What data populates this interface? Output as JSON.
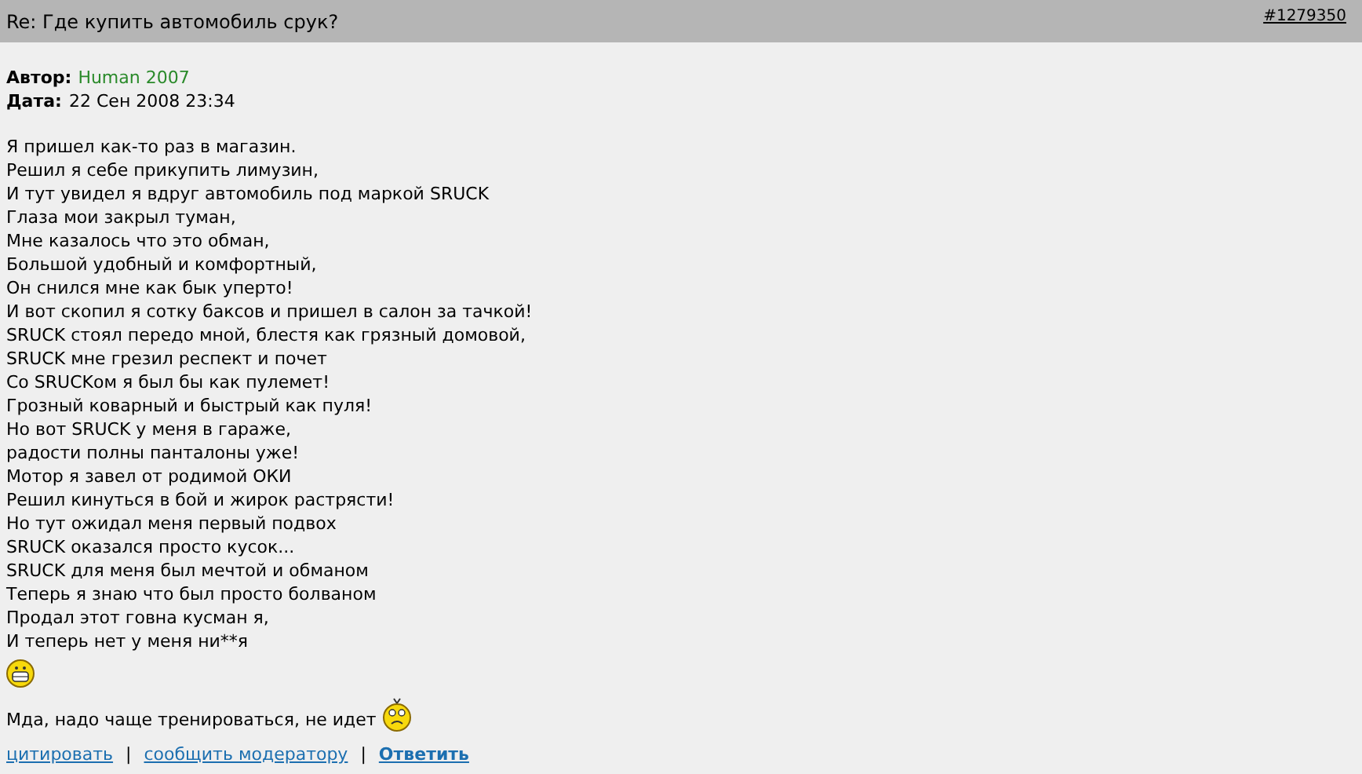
{
  "post": {
    "title": "Re: Где купить автомобиль срук?",
    "post_id": "#1279350",
    "author_label": "Автор:",
    "author": "Human 2007",
    "date_label": "Дата:",
    "date": "22 Сен 2008 23:34",
    "lines": [
      "Я пришел как-то раз в магазин.",
      "Решил я себе прикупить лимузин,",
      "И тут увидел я вдруг автомобиль под маркой SRUCK",
      "Глаза мои закрыл туман,",
      "Мне казалось что это обман,",
      "Большой удобный и комфортный,",
      "Он снился мне как бык уперто!",
      "И вот скопил я сотку баксов и пришел в салон за тачкой!",
      "SRUCK стоял передо мной, блестя как грязный домовой,",
      "SRUCK мне грезил респект и почет",
      "Со SRUCKом я был бы как пулемет!",
      "Грозный коварный и быстрый как пуля!",
      "Но вот SRUCK у меня в гараже,",
      "радости полны панталоны уже!",
      "Мотор я завел от родимой ОКИ",
      "Решил кинуться в бой и жирок растрясти!",
      "Но тут ожидал меня первый подвох",
      "SRUCK оказался просто кусок...",
      "SRUCK для меня был мечтой и обманом",
      "Теперь я знаю что был просто болваном",
      "Продал этот говна кусман я,",
      "И теперь нет у меня ни**я"
    ],
    "footer_text": "Мда, надо чаще тренироваться, не идет",
    "actions": [
      {
        "label": "цитировать",
        "bold": false
      },
      {
        "label": "сообщить модератору",
        "bold": false
      },
      {
        "label": "Ответить",
        "bold": true
      }
    ],
    "separator": "|"
  }
}
